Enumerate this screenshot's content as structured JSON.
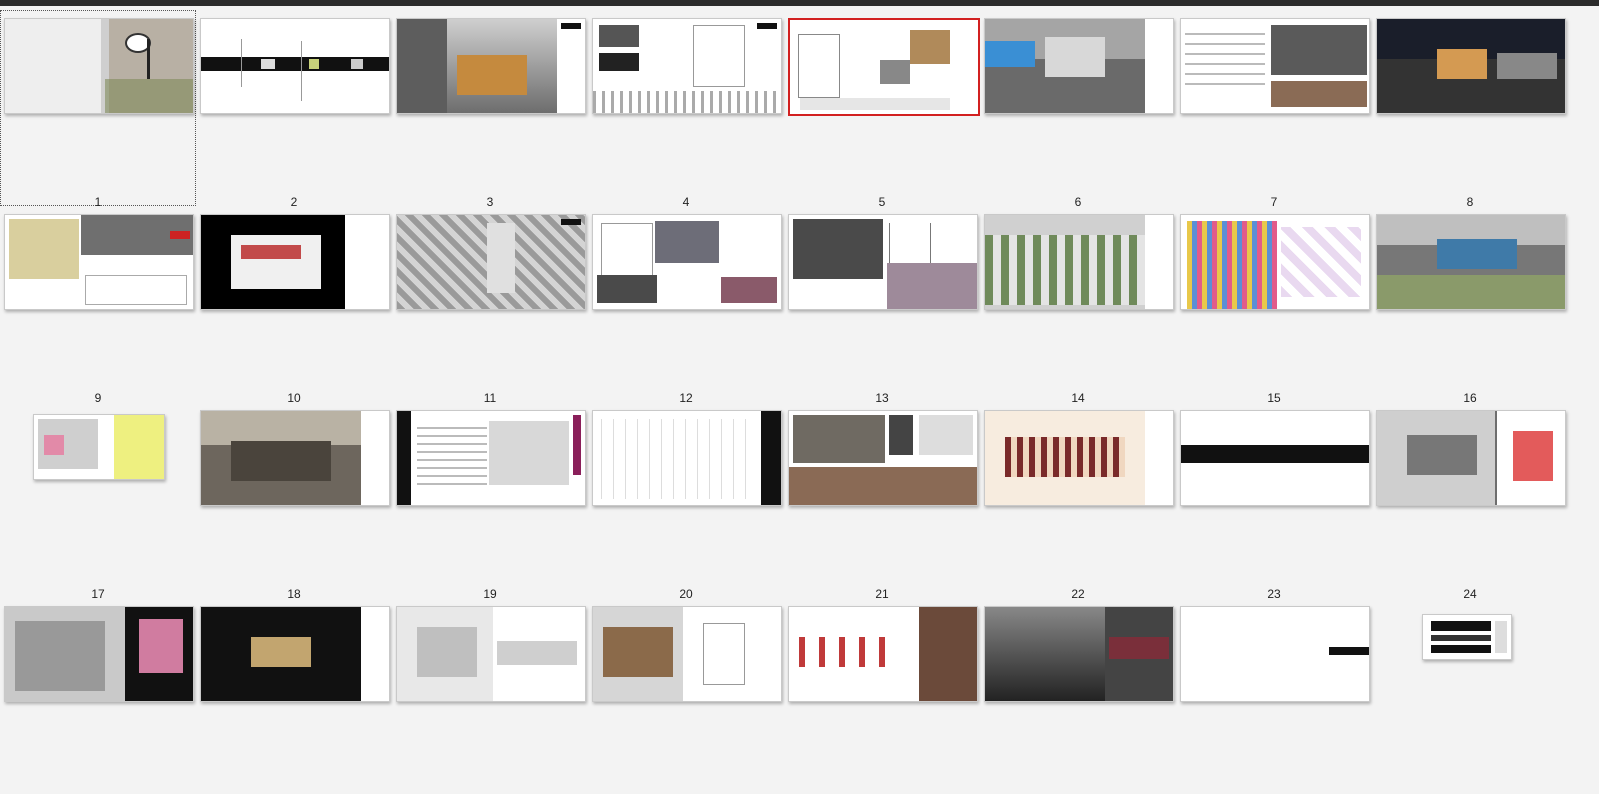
{
  "slides": [
    {
      "number": "1"
    },
    {
      "number": "2"
    },
    {
      "number": "3"
    },
    {
      "number": "4"
    },
    {
      "number": "5"
    },
    {
      "number": "6"
    },
    {
      "number": "7"
    },
    {
      "number": "8"
    },
    {
      "number": "9"
    },
    {
      "number": "10"
    },
    {
      "number": "11"
    },
    {
      "number": "12"
    },
    {
      "number": "13"
    },
    {
      "number": "14"
    },
    {
      "number": "15"
    },
    {
      "number": "16"
    },
    {
      "number": "17"
    },
    {
      "number": "18"
    },
    {
      "number": "19"
    },
    {
      "number": "20"
    },
    {
      "number": "21"
    },
    {
      "number": "22"
    },
    {
      "number": "23"
    },
    {
      "number": "24"
    }
  ],
  "selected_slide": "5"
}
